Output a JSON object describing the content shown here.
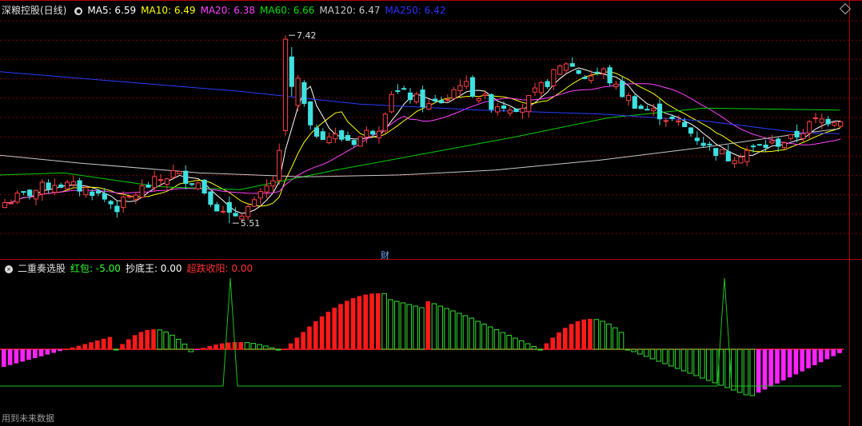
{
  "header": {
    "title": "深粮控股(日线)",
    "ma_labels": [
      {
        "text": "MA5: 6.59",
        "color": "#ffffff"
      },
      {
        "text": "MA10: 6.49",
        "color": "#ffff00"
      },
      {
        "text": "MA20: 6.38",
        "color": "#ff40ff"
      },
      {
        "text": "MA60: 6.66",
        "color": "#00e000"
      },
      {
        "text": "MA120: 6.47",
        "color": "#c8c8c8"
      },
      {
        "text": "MA250: 6.42",
        "color": "#3030ff"
      }
    ]
  },
  "indicator_header": {
    "title": "二重奏选股",
    "items": [
      {
        "text": "红包: -5.00",
        "color": "#30ff30"
      },
      {
        "text": "抄底王: 0.00",
        "color": "#ffffff"
      },
      {
        "text": "超跌收阳: 0.00",
        "color": "#ff3030"
      }
    ]
  },
  "footer_note": "用到未来数据",
  "fin_badge": "财",
  "colors": {
    "up": "#ff4040",
    "down": "#3fe0e0",
    "ma5": "#ffffff",
    "ma10": "#ffff00",
    "ma20": "#ff40ff",
    "ma60": "#00d000",
    "ma120": "#c8c8c8",
    "ma250": "#2a3cff",
    "bar_red": "#ff1a1a",
    "bar_magenta": "#ff22ff",
    "bar_green": "#30e030",
    "bar_yellow": "#ffff00",
    "zero_line": "#ff2020",
    "line_green": "#20c020",
    "grid": "#7a0000",
    "panel_border": "#b00000"
  },
  "chart_data": [
    {
      "type": "candlestick",
      "title": "深粮控股(日线)",
      "ylim": [
        5.3,
        7.6
      ],
      "annotations": [
        {
          "label": "7.42",
          "value": 7.42
        },
        {
          "label": "5.51",
          "value": 5.51
        }
      ]
    },
    {
      "type": "bar",
      "title": "二重奏选股",
      "series": [
        {
          "name": "红包",
          "last_value": -5.0
        },
        {
          "name": "抄底王",
          "last_value": 0.0
        },
        {
          "name": "超跌收阳",
          "last_value": 0.0
        }
      ]
    }
  ]
}
